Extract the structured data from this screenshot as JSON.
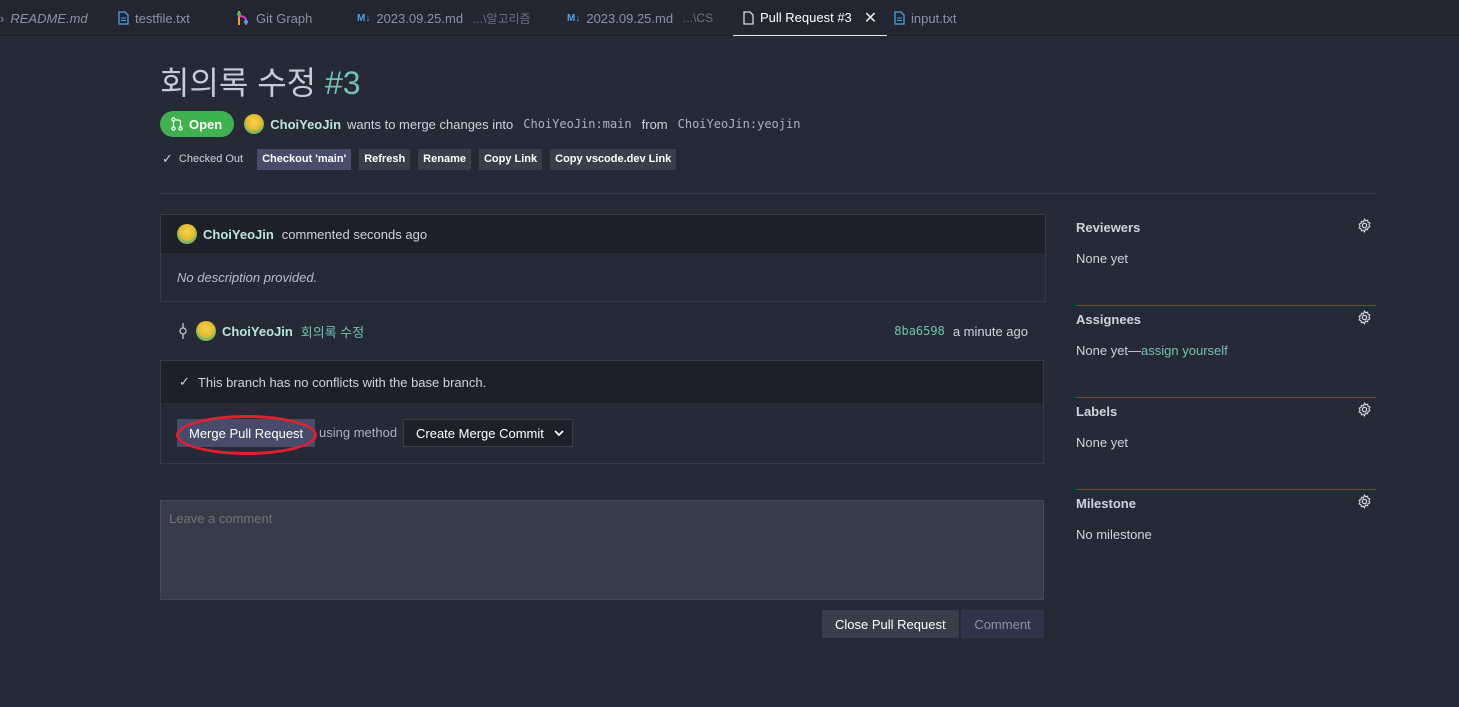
{
  "tabs": [
    {
      "label": "README.md",
      "italic": true
    },
    {
      "label": "testfile.txt"
    },
    {
      "label": "Git Graph"
    },
    {
      "label": "2023.09.25.md",
      "path": "...\\알고리즘"
    },
    {
      "label": "2023.09.25.md",
      "path": "...\\CS"
    },
    {
      "label": "Pull Request #3",
      "active": true
    },
    {
      "label": "input.txt"
    }
  ],
  "pr": {
    "title": "회의록 수정",
    "number": "#3",
    "status": "Open",
    "author": "ChoiYeoJin",
    "wants_text": "wants to merge changes into",
    "base": "ChoiYeoJin:main",
    "from_text": "from",
    "head": "ChoiYeoJin:yeojin"
  },
  "actions": {
    "checked_out": "Checked Out",
    "checkout": "Checkout 'main'",
    "refresh": "Refresh",
    "rename": "Rename",
    "copy_link": "Copy Link",
    "copy_vscode": "Copy vscode.dev Link"
  },
  "comment": {
    "author": "ChoiYeoJin",
    "meta": "commented seconds ago",
    "body": "No description provided."
  },
  "commit": {
    "author": "ChoiYeoJin",
    "message": "회의록 수정",
    "sha": "8ba6598",
    "time": "a minute ago"
  },
  "merge": {
    "status": "This branch has no conflicts with the base branch.",
    "button": "Merge Pull Request",
    "using": "using method",
    "method": "Create Merge Commit"
  },
  "new_comment": {
    "placeholder": "Leave a comment",
    "close_button": "Close Pull Request",
    "comment_button": "Comment"
  },
  "sidebar": {
    "reviewers": {
      "title": "Reviewers",
      "value": "None yet"
    },
    "assignees": {
      "title": "Assignees",
      "value": "None yet—",
      "link": "assign yourself"
    },
    "labels": {
      "title": "Labels",
      "value": "None yet"
    },
    "milestone": {
      "title": "Milestone",
      "value": "No milestone"
    }
  },
  "colors": {
    "accent": "#70c1b3",
    "open": "#3fb14f",
    "highlight_ring": "#e0202f"
  }
}
